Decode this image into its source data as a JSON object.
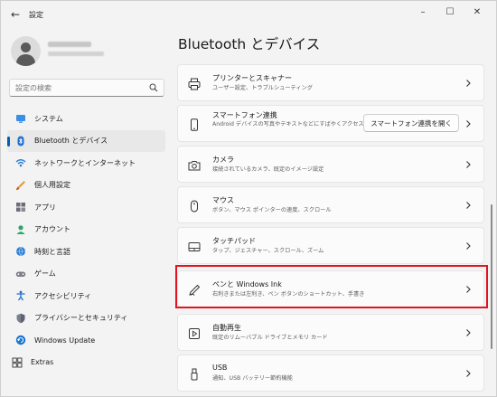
{
  "window": {
    "title": "設定",
    "controls": [
      "minimize",
      "maximize",
      "close"
    ]
  },
  "profile": {
    "name_redacted": true,
    "email_redacted": true
  },
  "search": {
    "placeholder": "設定の検索"
  },
  "nav": {
    "items": [
      {
        "label": "システム",
        "icon": "system-icon",
        "selected": false
      },
      {
        "label": "Bluetooth とデバイス",
        "icon": "bluetooth-icon",
        "selected": true
      },
      {
        "label": "ネットワークとインターネット",
        "icon": "wifi-icon",
        "selected": false
      },
      {
        "label": "個人用設定",
        "icon": "brush-icon",
        "selected": false
      },
      {
        "label": "アプリ",
        "icon": "apps-icon",
        "selected": false
      },
      {
        "label": "アカウント",
        "icon": "account-icon",
        "selected": false
      },
      {
        "label": "時刻と言語",
        "icon": "globe-clock-icon",
        "selected": false
      },
      {
        "label": "ゲーム",
        "icon": "gamepad-icon",
        "selected": false
      },
      {
        "label": "アクセシビリティ",
        "icon": "accessibility-icon",
        "selected": false
      },
      {
        "label": "プライバシーとセキュリティ",
        "icon": "shield-icon",
        "selected": false
      },
      {
        "label": "Windows Update",
        "icon": "update-icon",
        "selected": false
      },
      {
        "label": "Extras",
        "icon": "extras-icon",
        "selected": false
      }
    ]
  },
  "page": {
    "title": "Bluetooth とデバイス"
  },
  "cards": [
    {
      "title": "プリンターとスキャナー",
      "desc": "ユーザー設定、トラブルシューティング",
      "icon": "printer-icon"
    },
    {
      "title": "スマートフォン連携",
      "desc": "Android デバイスの写真やテキストなどにすばやくアクセスで\nきます",
      "icon": "phone-icon",
      "button": "スマートフォン連携を開く"
    },
    {
      "title": "カメラ",
      "desc": "接続されているカメラ、既定のイメージ設定",
      "icon": "camera-icon"
    },
    {
      "title": "マウス",
      "desc": "ボタン、マウス ポインターの速度、スクロール",
      "icon": "mouse-icon"
    },
    {
      "title": "タッチパッド",
      "desc": "タップ、ジェスチャー、スクロール、ズーム",
      "icon": "touchpad-icon"
    },
    {
      "title": "ペンと Windows Ink",
      "desc": "右利きまたは左利き、ペン ボタンのショートカット、手書き",
      "icon": "pen-icon",
      "highlighted": true
    },
    {
      "title": "自動再生",
      "desc": "既定のリムーバブル ドライブとメモリ カード",
      "icon": "autoplay-icon"
    },
    {
      "title": "USB",
      "desc": "通知、USB バッテリー節約機能",
      "icon": "usb-icon"
    }
  ],
  "colors": {
    "accent": "#005fb8",
    "highlight": "#e3131f",
    "background": "#f3f3f3"
  }
}
